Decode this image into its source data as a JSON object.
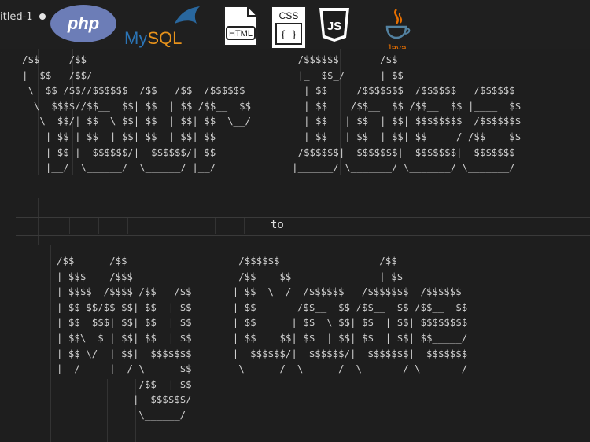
{
  "tab": {
    "title": "itled-1"
  },
  "logos": {
    "php": "php",
    "mysql_my": "My",
    "mysql_sql": "SQL",
    "html": "HTML",
    "css": "CSS",
    "css_braces": "{ }",
    "js": "JS",
    "java": "Java"
  },
  "editor": {
    "ascii_top": "/$$     /$$                                    /$$$$$$       /$$\n|  $$   /$$/                                   |_  $$_/      | $$\n \\  $$ /$$//$$$$$$  /$$   /$$  /$$$$$$          | $$     /$$$$$$$  /$$$$$$   /$$$$$$\n  \\  $$$$//$$__  $$| $$  | $$ /$$__  $$         | $$    /$$__  $$ /$$__  $$ |____  $$\n   \\  $$/| $$  \\ $$| $$  | $$| $$  \\__/         | $$   | $$  | $$| $$$$$$$$  /$$$$$$$\n    | $$ | $$  | $$| $$  | $$| $$               | $$   | $$  | $$| $$_____/ /$$__  $$\n    | $$ |  $$$$$$/|  $$$$$$/| $$              /$$$$$$|  $$$$$$$|  $$$$$$$|  $$$$$$$\n    |__/  \\______/  \\______/ |__/             |______/ \\_______/ \\_______/ \\_______/",
    "middle_text": "to",
    "ascii_bottom": "/$$      /$$                   /$$$$$$                 /$$\n| $$$    /$$$                  /$$__  $$               | $$\n| $$$$  /$$$$ /$$   /$$       | $$  \\__/  /$$$$$$   /$$$$$$$  /$$$$$$\n| $$ $$/$$ $$| $$  | $$       | $$       /$$__  $$ /$$__  $$ /$$__  $$\n| $$  $$$| $$| $$  | $$       | $$      | $$  \\ $$| $$  | $$| $$$$$$$$\n| $$\\  $ | $$| $$  | $$       | $$    $$| $$  | $$| $$  | $$| $$_____/\n| $$ \\/  | $$|  $$$$$$$       |  $$$$$$/|  $$$$$$/|  $$$$$$$|  $$$$$$$\n|__/     |__/ \\____  $$        \\______/  \\______/  \\_______/ \\_______/\n              /$$  | $$\n             |  $$$$$$/\n              \\______/"
  }
}
